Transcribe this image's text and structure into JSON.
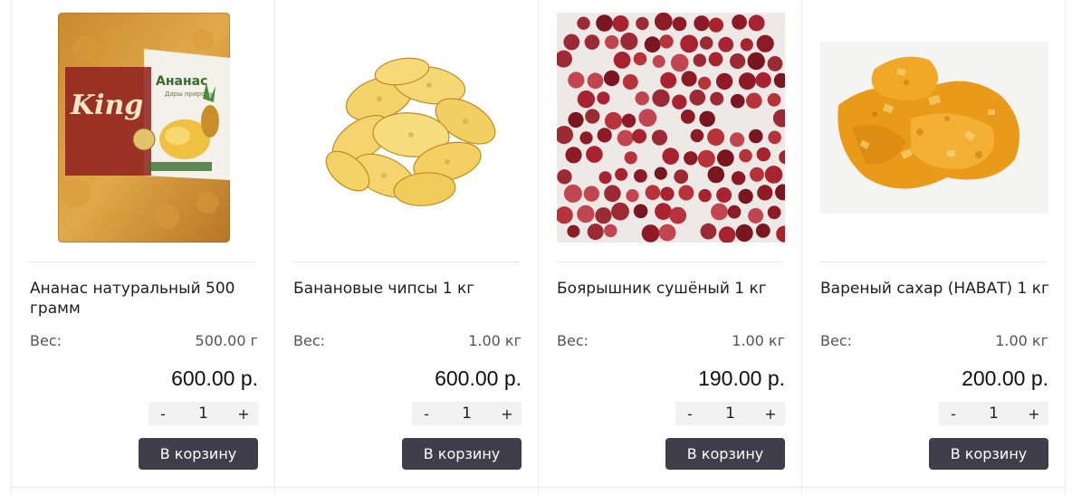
{
  "products": [
    {
      "image": "pineapple-pack-image",
      "package_brand": "King",
      "package_label": "Ананас",
      "package_sub": "Дары природы",
      "title": "Ананас натуральный 500 грамм",
      "weight_label": "Вес:",
      "weight_value": "500.00 г",
      "price": "600.00 р.",
      "qty_minus": "-",
      "qty_value": "1",
      "qty_plus": "+",
      "cart_label": "В корзину"
    },
    {
      "image": "banana-chips-image",
      "title": "Банановые чипсы 1 кг",
      "weight_label": "Вес:",
      "weight_value": "1.00 кг",
      "price": "600.00 р.",
      "qty_minus": "-",
      "qty_value": "1",
      "qty_plus": "+",
      "cart_label": "В корзину"
    },
    {
      "image": "dried-hawthorn-image",
      "title": "Боярышник сушёный 1 кг",
      "weight_label": "Вес:",
      "weight_value": "1.00 кг",
      "price": "190.00 р.",
      "qty_minus": "-",
      "qty_value": "1",
      "qty_plus": "+",
      "cart_label": "В корзину"
    },
    {
      "image": "nabat-sugar-image",
      "title": "Вареный сахар (НАВАТ) 1 кг",
      "weight_label": "Вес:",
      "weight_value": "1.00 кг",
      "price": "200.00 р.",
      "qty_minus": "-",
      "qty_value": "1",
      "qty_plus": "+",
      "cart_label": "В корзину"
    }
  ],
  "colors": {
    "button_bg": "#3f3e4a",
    "qty_bg": "#f2f2f2",
    "border": "#ebebeb"
  }
}
